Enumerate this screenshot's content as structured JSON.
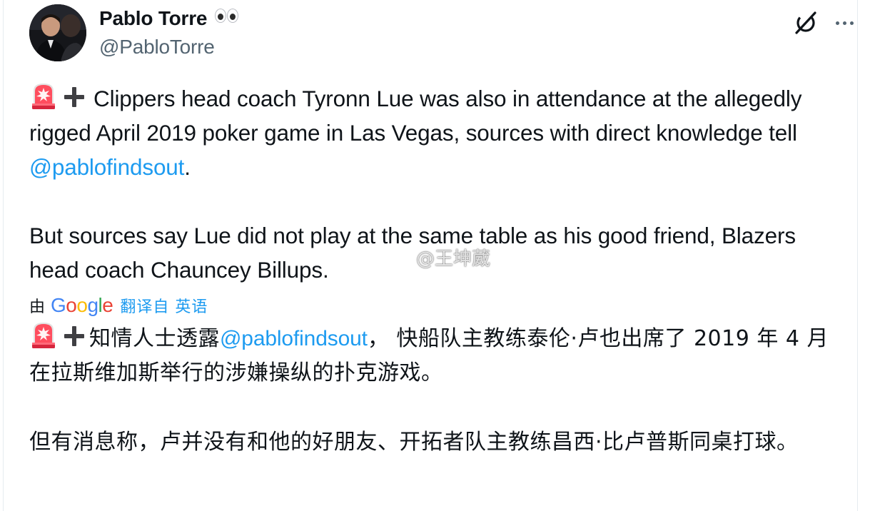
{
  "author": {
    "display_name": "Pablo Torre",
    "name_emoji": "eyes-emoji",
    "handle": "@PabloTorre"
  },
  "actions": {
    "grok_icon": "grok-icon",
    "more_icon": "more-icon"
  },
  "tweet": {
    "en_paragraph1_pre": "Clippers head coach Tyronn Lue was also in attendance at the allegedly rigged April 2019 poker game in Las Vegas, sources with direct knowledge tell ",
    "en_paragraph1_link": "@pablofindsout",
    "en_paragraph1_post": ".",
    "en_paragraph2": "But sources say Lue did not play at the same table as his good friend, Blazers head coach Chauncey Billups."
  },
  "translation": {
    "by_label": "由",
    "provider": "Google",
    "from_label": "翻译自 英语",
    "cn_paragraph1_pre": "知情人士透露",
    "cn_paragraph1_link": "@pablofindsout",
    "cn_paragraph1_post": "， 快船队主教练泰伦·卢也出席了 2019 年 4 月在拉斯维加斯举行的涉嫌操纵的扑克游戏。",
    "cn_paragraph2": "但有消息称，卢并没有和他的好朋友、开拓者队主教练昌西·比卢普斯同桌打球。"
  },
  "watermark": {
    "text": "@王坤葳"
  },
  "colors": {
    "link": "#1d9bf0",
    "text": "#0f1419",
    "secondary": "#536471"
  }
}
